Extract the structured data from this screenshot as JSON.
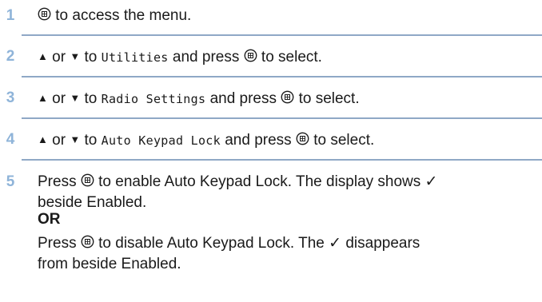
{
  "steps": [
    {
      "num": "1",
      "text": "to access the menu."
    },
    {
      "num": "2",
      "up": "▲",
      "or": "or",
      "down": "▼",
      "to": "to",
      "target": "Utilities",
      "press": "and press",
      "end": "to select."
    },
    {
      "num": "3",
      "up": "▲",
      "or": "or",
      "down": "▼",
      "to": "to",
      "target": "Radio Settings",
      "press": "and press",
      "end": "to select."
    },
    {
      "num": "4",
      "up": "▲",
      "or": "or",
      "down": "▼",
      "to": "to",
      "target": "Auto Keypad Lock",
      "press": "and press",
      "end": "to select."
    },
    {
      "num": "5",
      "a_press": "Press",
      "a_text": "to enable Auto Keypad Lock. The display shows ✓",
      "a_cont": "beside Enabled.",
      "or_label": "OR",
      "b_press": "Press",
      "b_text": "to disable Auto Keypad Lock. The ✓ disappears",
      "b_cont": "from beside Enabled."
    }
  ],
  "icons": {
    "menu_button": "menu-ok-button-icon",
    "up": "up-arrow-icon",
    "down": "down-arrow-icon"
  }
}
